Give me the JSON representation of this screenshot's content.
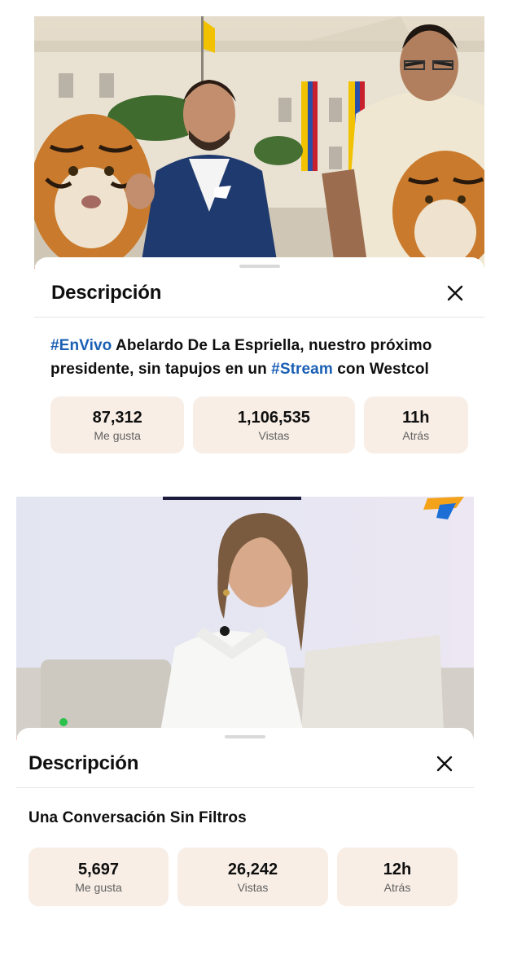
{
  "posts": [
    {
      "progress": 0.03,
      "title": "Descripción",
      "description": {
        "hashtag1": "#EnVivo",
        "text1": " Abelardo De La Espriella, nuestro próximo presidente, sin tapujos en un ",
        "hashtag2": "#Stream",
        "text2": " con Westcol"
      },
      "stats": {
        "likes": "87,312",
        "likes_label": "Me gusta",
        "views": "1,106,535",
        "views_label": "Vistas",
        "ago": "11h",
        "ago_label": "Atrás"
      }
    },
    {
      "progress": 0.43,
      "title": "Descripción",
      "description": {
        "text": "Una Conversación Sin Filtros"
      },
      "stats": {
        "likes": "5,697",
        "likes_label": "Me gusta",
        "views": "26,242",
        "views_label": "Vistas",
        "ago": "12h",
        "ago_label": "Atrás"
      }
    }
  ],
  "colors": {
    "hashtag": "#1a5fb4",
    "progress": "#ff0000",
    "stat_bg": "#f8eee6"
  },
  "icons": [
    "close-icon"
  ]
}
